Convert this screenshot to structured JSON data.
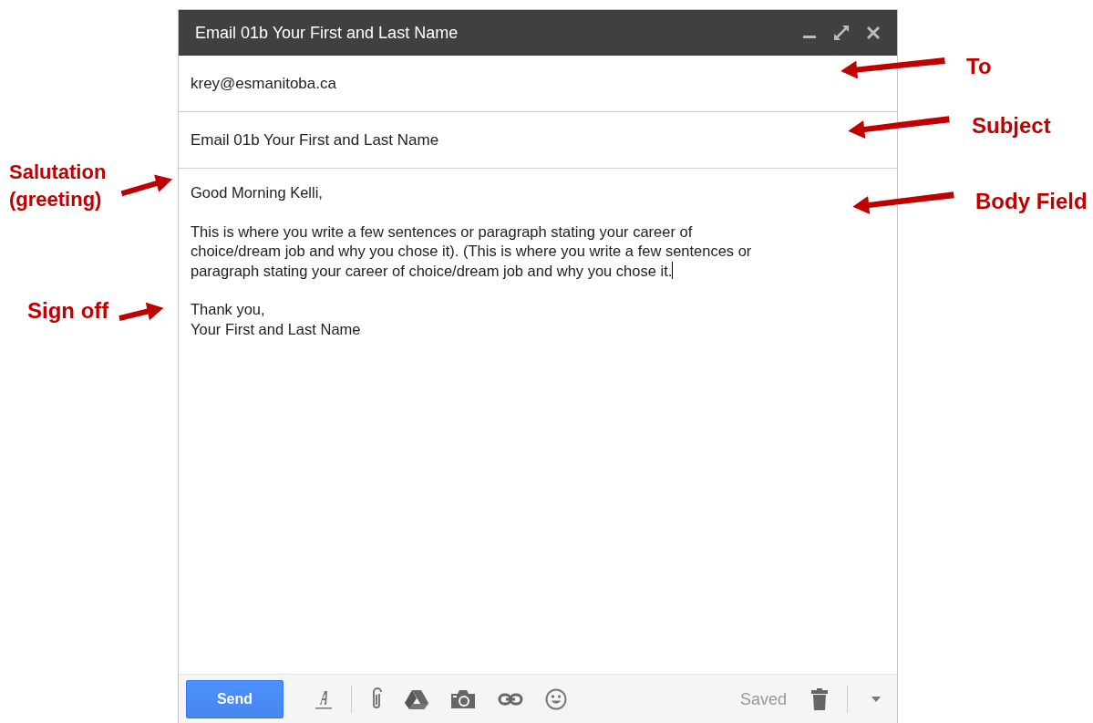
{
  "window": {
    "title": "Email 01b Your First and Last Name"
  },
  "to": {
    "value": "krey@esmanitoba.ca"
  },
  "subject": {
    "value": "Email 01b Your First and Last Name"
  },
  "body": {
    "paragraphs": [
      {
        "lines": [
          "Good Morning Kelli,"
        ],
        "caret": false
      },
      {
        "lines": [
          "This is where you write a few sentences or paragraph stating your career of",
          "choice/dream job and why you chose it). (This is where you write a few sentences or",
          "paragraph stating your career of choice/dream job and why you chose it."
        ],
        "caret": true
      },
      {
        "lines": [
          "Thank you,",
          "Your First and Last Name"
        ],
        "caret": false
      }
    ]
  },
  "toolbar": {
    "send": "Send",
    "status": "Saved"
  },
  "annotations_right": [
    {
      "label": "To"
    },
    {
      "label": "Subject"
    },
    {
      "label": "Body Field"
    }
  ],
  "annotations_left": [
    {
      "label": "Salutation (greeting)"
    },
    {
      "label": "Sign off"
    }
  ]
}
